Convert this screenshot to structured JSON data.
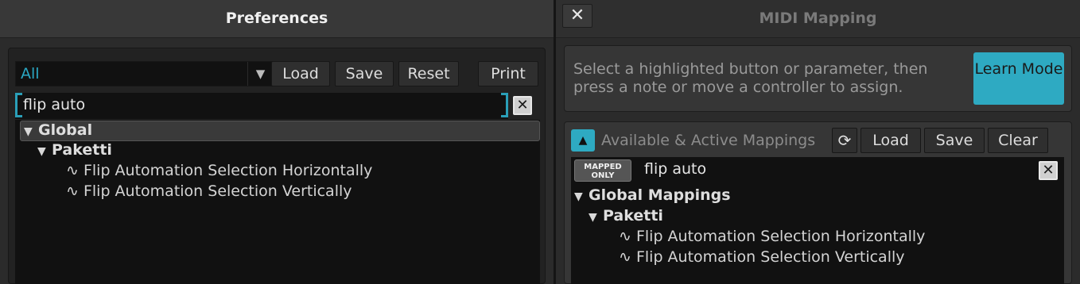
{
  "preferences": {
    "title": "Preferences",
    "filter_value": "All",
    "buttons": {
      "load": "Load",
      "save": "Save",
      "reset": "Reset",
      "print": "Print"
    },
    "search_value": "flip auto",
    "tree": [
      {
        "label": "Global",
        "level": 0,
        "type": "group"
      },
      {
        "label": "Paketti",
        "level": 1,
        "type": "group"
      },
      {
        "label": "Flip Automation Selection Horizontally",
        "level": 2,
        "type": "item"
      },
      {
        "label": "Flip Automation Selection Vertically",
        "level": 2,
        "type": "item"
      }
    ]
  },
  "midi_mapping": {
    "title": "MIDI Mapping",
    "close_glyph": "✕",
    "instructions": "Select a highlighted button or parameter, then press a note or move a controller to assign.",
    "learn_mode": "Learn Mode",
    "section_label": "Available & Active Mappings",
    "buttons": {
      "load": "Load",
      "save": "Save",
      "clear": "Clear"
    },
    "mapped_only": "MAPPED ONLY",
    "search_value": "flip auto",
    "tree": [
      {
        "label": "Global Mappings",
        "level": 0,
        "type": "group"
      },
      {
        "label": "Paketti",
        "level": 1,
        "type": "group"
      },
      {
        "label": "Flip Automation Selection Horizontally",
        "level": 2,
        "type": "item"
      },
      {
        "label": "Flip Automation Selection Vertically",
        "level": 2,
        "type": "item"
      }
    ]
  },
  "icons": {
    "tree_expanded": "▼",
    "automation": "∿",
    "dropdown": "▼",
    "clear_x": "✕",
    "collapse_up": "▲",
    "sync": "⟳"
  },
  "colors": {
    "accent": "#2eaac2"
  }
}
